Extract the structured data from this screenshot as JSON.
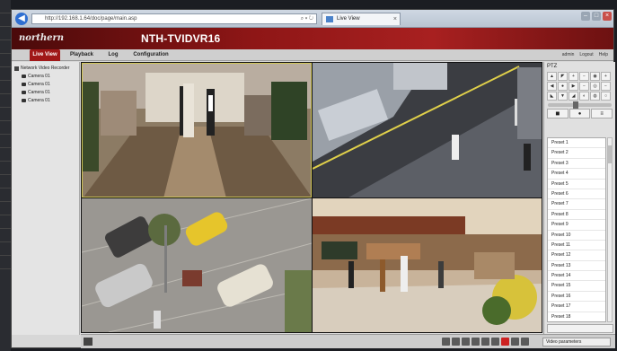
{
  "browser": {
    "url": "http://192.168.1.64/doc/page/main.asp",
    "tab_title": "Live View",
    "back_icon": "back-arrow-icon",
    "window_controls": [
      "min",
      "max",
      "close"
    ]
  },
  "app": {
    "logo": "northern",
    "title": "NTH-TVIDVR16",
    "accent": "#a01818"
  },
  "nav": {
    "tabs": [
      {
        "label": "Live View",
        "active": true
      },
      {
        "label": "Playback",
        "active": false
      },
      {
        "label": "Log",
        "active": false
      },
      {
        "label": "Configuration",
        "active": false
      }
    ],
    "user_links": [
      "admin",
      "Logout",
      "Help"
    ]
  },
  "tree": {
    "root": "Network Video Recorder",
    "cameras": [
      "Camera 01",
      "Camera 01",
      "Camera 01",
      "Camera 01"
    ]
  },
  "ptz": {
    "title": "PTZ",
    "controls": [
      "▲",
      "◤",
      "+",
      "−",
      "◉",
      "+",
      "◀",
      "●",
      "▶",
      "−",
      "◎",
      "−",
      "◣",
      "▼",
      "◢",
      "◐",
      "◍",
      "○"
    ],
    "tabs": [
      "◼",
      "●",
      "≡"
    ],
    "presets": [
      "Preset 1",
      "Preset 2",
      "Preset 3",
      "Preset 4",
      "Preset 5",
      "Preset 6",
      "Preset 7",
      "Preset 8",
      "Preset 9",
      "Preset 10",
      "Preset 11",
      "Preset 12",
      "Preset 13",
      "Preset 14",
      "Preset 15",
      "Preset 16",
      "Preset 17",
      "Preset 18"
    ],
    "footer": ""
  },
  "toolbar": {
    "video_params": "Video parameters"
  }
}
